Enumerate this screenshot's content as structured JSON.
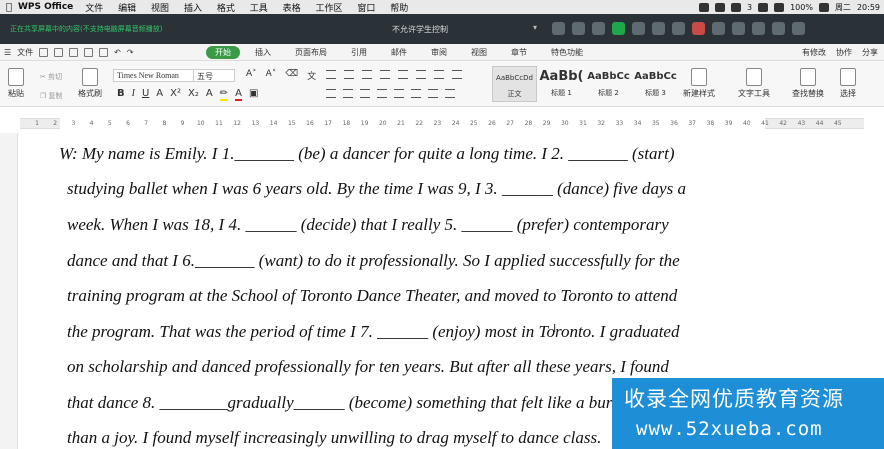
{
  "mac_menu": {
    "app_name": "WPS Office",
    "items": [
      "文件",
      "编辑",
      "视图",
      "插入",
      "格式",
      "工具",
      "表格",
      "工作区",
      "窗口",
      "帮助"
    ],
    "status": {
      "count": "3",
      "battery": "100%",
      "day": "周二",
      "time": "20:59"
    }
  },
  "title_bar": {
    "notice": "正在共享屏幕中的内容(不支持电脑屏幕音频播放)",
    "doc_title": "不允许学生控制"
  },
  "app_menu": {
    "file": "文件",
    "tabs": [
      "开始",
      "插入",
      "页面布局",
      "引用",
      "邮件",
      "审阅",
      "视图",
      "章节",
      "特色功能"
    ],
    "active_tab": "开始",
    "right": [
      "有修改",
      "协作",
      "分享"
    ]
  },
  "ribbon": {
    "paste": "粘贴",
    "cut": "剪切",
    "copy": "复制",
    "format_painter": "格式刷",
    "font_name": "Times New Roman",
    "font_size": "五号",
    "styles": [
      {
        "sample": "AaBbCcDd",
        "label": "正文"
      },
      {
        "sample": "AaBb(",
        "label": "标题 1"
      },
      {
        "sample": "AaBbCc",
        "label": "标题 2"
      },
      {
        "sample": "AaBbCc",
        "label": "标题 3"
      }
    ],
    "new_style": "新建样式",
    "text_tools": "文字工具",
    "find_replace": "查找替换",
    "select": "选择"
  },
  "ruler": {
    "numbers": [
      "1",
      "2",
      "3",
      "4",
      "5",
      "6",
      "7",
      "8",
      "9",
      "10",
      "11",
      "12",
      "13",
      "14",
      "15",
      "16",
      "17",
      "18",
      "19",
      "20",
      "21",
      "22",
      "23",
      "24",
      "25",
      "26",
      "27",
      "28",
      "29",
      "30",
      "31",
      "32",
      "33",
      "34",
      "35",
      "36",
      "37",
      "38",
      "39",
      "40",
      "41",
      "42",
      "43",
      "44",
      "45"
    ]
  },
  "document": {
    "lines": [
      "W: My name is Emily. I 1._______  (be) a dancer for quite a long time. I 2. _______  (start)",
      "studying ballet when I was 6 years old. By the time I was 9, I 3. ______  (dance) five days a",
      "week. When I was 18, I 4. ______  (decide) that I really 5. ______  (prefer) contemporary",
      "dance and that I 6._______  (want) to do it professionally. So I applied successfully for the",
      "training program at the School of Toronto Dance Theater, and moved to Toronto to attend",
      "the program. That was the period of time I 7. ______  (enjoy) most in Toronto. I graduated",
      "on scholarship and danced professionally for ten years. But after all these years, I found",
      "that dance 8. ________gradually______  (become) something that felt like a burden rather",
      "than a joy. I found myself increasingly unwilling to drag myself to dance class."
    ]
  },
  "watermark": {
    "line1": "收录全网优质教育资源",
    "line2": "www.52xueba.com"
  }
}
